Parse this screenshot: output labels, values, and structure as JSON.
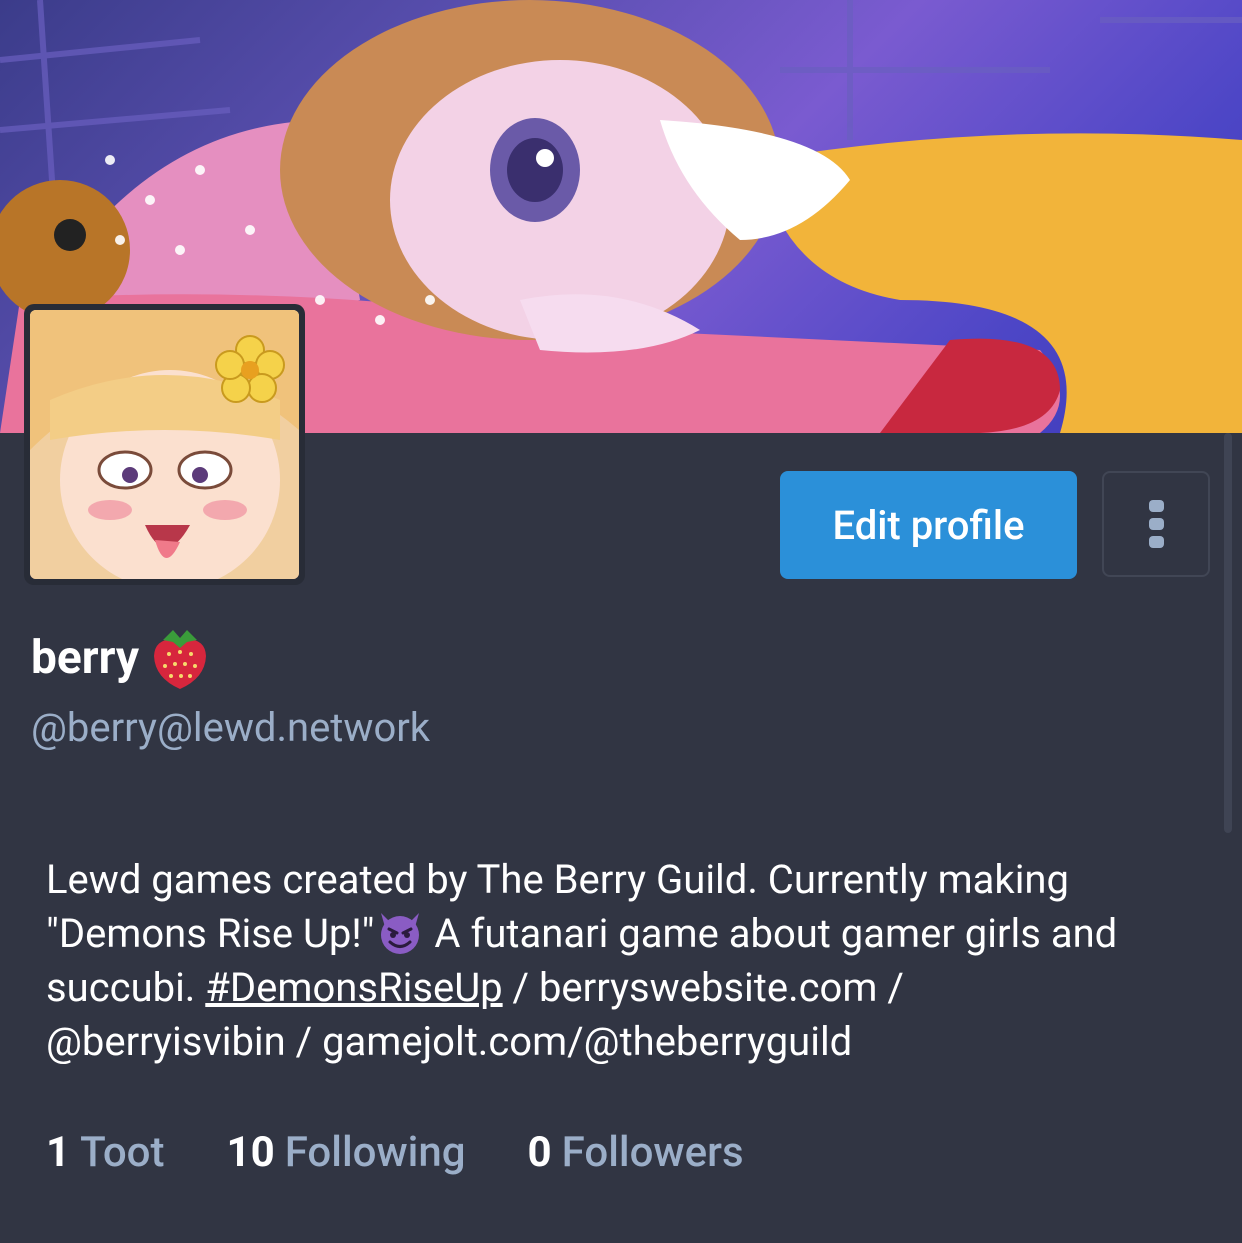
{
  "profile": {
    "display_name": "berry",
    "name_emoji": "strawberry",
    "handle": "@berry@lewd.network",
    "edit_label": "Edit profile",
    "bio": {
      "line1": "Lewd games created by The Berry Guild. Currently making",
      "line2_a": "\"Demons Rise Up!\"",
      "line2_emoji": "smiling-imp",
      "line2_b": " A futanari game about gamer girls and",
      "line3_a": "succubi. ",
      "hashtag": "#DemonsRiseUp",
      "line3_b": " / berryswebsite.com /",
      "line4": "@berryisvibin / gamejolt.com/@theberryguild"
    },
    "stats": [
      {
        "count": "1",
        "label": "Toot"
      },
      {
        "count": "10",
        "label": "Following"
      },
      {
        "count": "0",
        "label": "Followers"
      }
    ]
  },
  "colors": {
    "background": "#313543",
    "accent": "#2b90d9",
    "secondary_text": "#9baec8"
  }
}
